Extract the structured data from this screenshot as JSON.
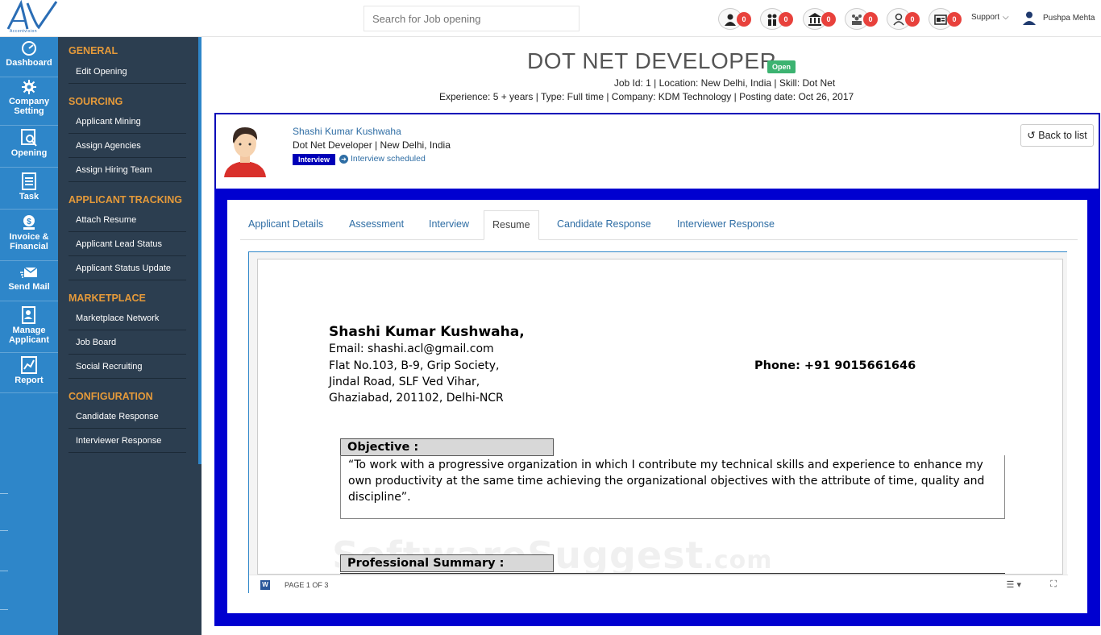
{
  "app": {
    "logo_text": "Accentvision",
    "search_placeholder": "Search for Job opening"
  },
  "notifications": [
    {
      "icon": "person-icon",
      "count": "0"
    },
    {
      "icon": "people-icon",
      "count": "0"
    },
    {
      "icon": "bank-icon",
      "count": "0"
    },
    {
      "icon": "team-icon",
      "count": "0"
    },
    {
      "icon": "users-icon",
      "count": "0"
    },
    {
      "icon": "id-card-icon",
      "count": "0"
    }
  ],
  "header_right": {
    "support": "Support",
    "user_name": "Pushpa Mehta"
  },
  "iconbar": [
    {
      "label_1": "Dashboard",
      "label_2": ""
    },
    {
      "label_1": "Company",
      "label_2": "Setting"
    },
    {
      "label_1": "Opening",
      "label_2": ""
    },
    {
      "label_1": "Task",
      "label_2": ""
    },
    {
      "label_1": "Invoice &",
      "label_2": "Financial"
    },
    {
      "label_1": "Send Mail",
      "label_2": ""
    },
    {
      "label_1": "Manage",
      "label_2": "Applicant"
    },
    {
      "label_1": "Report",
      "label_2": ""
    }
  ],
  "menu": {
    "general": "GENERAL",
    "edit_opening": "Edit Opening",
    "sourcing": "SOURCING",
    "applicant_mining": "Applicant Mining",
    "assign_agencies": "Assign Agencies",
    "assign_hiring_team": "Assign Hiring Team",
    "applicant_tracking": "APPLICANT TRACKING",
    "attach_resume": "Attach Resume",
    "applicant_lead_status": "Applicant Lead Status",
    "applicant_status_update": "Applicant Status Update",
    "marketplace": "MARKETPLACE",
    "marketplace_network": "Marketplace Network",
    "job_board": "Job Board",
    "social_recruiting": "Social Recruiting",
    "configuration": "CONFIGURATION",
    "candidate_response": "Candidate Response",
    "interviewer_response": "Interviewer Response"
  },
  "job": {
    "title": "DOT NET DEVELOPER",
    "status": "Open",
    "line1": "Job Id: 1 | Location: New Delhi, India | Skill: Dot Net",
    "line2": "Experience: 5 + years | Type: Full time | Company: KDM Technology | Posting date: Oct 26, 2017"
  },
  "candidate": {
    "name": "Shashi Kumar Kushwaha",
    "role": "Dot Net Developer | New Delhi, India",
    "stage": "Interview",
    "stage_status": "Interview scheduled",
    "back_label": "Back to list"
  },
  "tabs": [
    {
      "label": "Applicant Details"
    },
    {
      "label": "Assessment"
    },
    {
      "label": "Interview"
    },
    {
      "label": "Resume"
    },
    {
      "label": "Candidate Response"
    },
    {
      "label": "Interviewer Response"
    }
  ],
  "active_tab": "Resume",
  "resume": {
    "name": "Shashi Kumar Kushwaha,",
    "email": "Email:  shashi.acl@gmail.com",
    "addr1": "Flat No.103, B-9, Grip Society,",
    "addr2": "Jindal Road, SLF Ved Vihar,",
    "addr3": "Ghaziabad, 201102, Delhi-NCR",
    "phone": "Phone:  +91 9015661646",
    "objective_head": "Objective :",
    "objective_text": "“To work with a progressive organization in which I contribute my technical skills and experience to enhance my own productivity at the same time achieving the organizational objectives with the attribute of time, quality and discipline”.",
    "summary_head": "Professional Summary :",
    "watermark": "SoftwareSuggest",
    "watermark_tld": ".com"
  },
  "viewer": {
    "word_badge": "W",
    "page_count": "PAGE 1 OF 3",
    "menu_glyph": "☰ ▾",
    "fullscreen_glyph": "⛶"
  }
}
